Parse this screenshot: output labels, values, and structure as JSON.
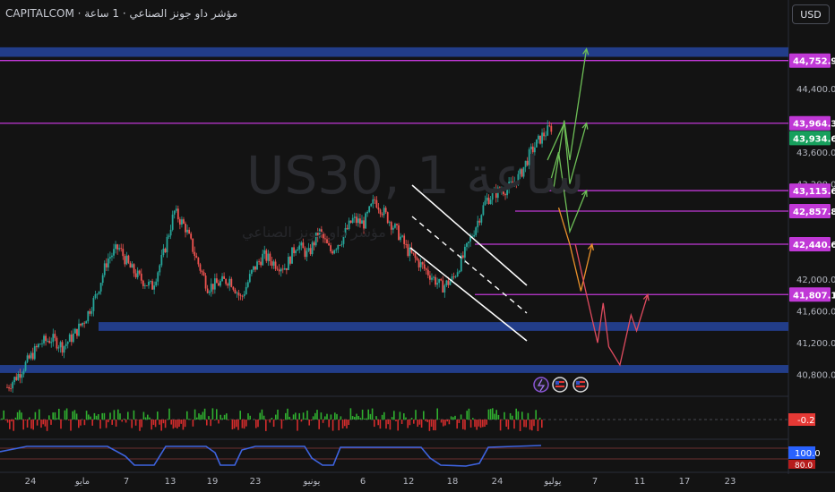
{
  "header": {
    "title": "CAPITALCOM ·  مؤشر داو جونز الصناعي · 1 ساعة",
    "currency_button": "USD"
  },
  "watermark": {
    "symbol": "US30, 1 ساعة",
    "subtitle": "مؤشر داو جونز الصناعي"
  },
  "colors": {
    "background": "#131313",
    "zone_blue": "#233f8f",
    "level_purple": "#c038d6",
    "candle_up": "#26a69a",
    "candle_down": "#ef5350",
    "projection_green": "#6ebf57",
    "projection_orange": "#e8902a",
    "projection_red": "#e04b5f",
    "channel": "#ffffff",
    "last_price_green": "#17a05d",
    "osc_up": "#2fae2f",
    "osc_down": "#d42c2c",
    "osc2_line": "#3e64e0"
  },
  "chart_data": {
    "type": "candlestick",
    "symbol": "US30",
    "interval": "1 ساعة",
    "y_axis": {
      "range": [
        40560,
        45200
      ],
      "ticks": [
        "44,400.0",
        "43,600.0",
        "43,200.0",
        "42,000.0",
        "41,600.0",
        "41,200.0",
        "40,800.0"
      ],
      "tick_values": [
        44400,
        43600,
        43200,
        42000,
        41600,
        41200,
        40800
      ]
    },
    "x_axis": {
      "labels": [
        "24",
        "مايو",
        "7",
        "13",
        "19",
        "23",
        "يونيو",
        "6",
        "12",
        "18",
        "24",
        "يوليو",
        "7",
        "11",
        "17",
        "23"
      ]
    },
    "price_labels": [
      {
        "text": "44,752.9",
        "value": 44752.9,
        "color": "#c038d6"
      },
      {
        "text": "43,964.3",
        "value": 43964.3,
        "color": "#c038d6"
      },
      {
        "text": "43,934.6",
        "value": 43934.6,
        "color": "#17a05d"
      },
      {
        "text": "43,115.6",
        "value": 43115.6,
        "color": "#c038d6"
      },
      {
        "text": "42,857.8",
        "value": 42857.8,
        "color": "#c038d6"
      },
      {
        "text": "42,440.6",
        "value": 42440.6,
        "color": "#c038d6"
      },
      {
        "text": "41,807.1",
        "value": 41807.1,
        "color": "#c038d6"
      }
    ],
    "horizontal_levels": [
      44752.9,
      43964.3,
      43115.6,
      42857.8,
      42440.6,
      41807.1
    ],
    "zones": [
      {
        "from": 44800,
        "to": 44920
      },
      {
        "from": 41350,
        "to": 41460
      },
      {
        "from": 40820,
        "to": 40920
      }
    ],
    "price_path_day": [
      0,
      2,
      4,
      6,
      8,
      10,
      12,
      14,
      16,
      18,
      20,
      22,
      24,
      26,
      28,
      30,
      32,
      34,
      36,
      38,
      40,
      42,
      44,
      46,
      48,
      50,
      52,
      54,
      56,
      58,
      60,
      62,
      64,
      66,
      68,
      70,
      72,
      74,
      76,
      78,
      80,
      82,
      84,
      86,
      88,
      90,
      92,
      94,
      96,
      98
    ],
    "price_path_close": [
      40640,
      40800,
      41000,
      41200,
      41250,
      41150,
      41300,
      41500,
      41800,
      42250,
      42400,
      42150,
      42000,
      41900,
      42300,
      42850,
      42650,
      42250,
      41900,
      41950,
      42000,
      41750,
      42100,
      42300,
      42200,
      42150,
      42450,
      42300,
      42600,
      42350,
      42500,
      42750,
      42700,
      43000,
      42800,
      42600,
      42350,
      42200,
      42050,
      41900,
      42000,
      42300,
      42650,
      43000,
      43100,
      43150,
      43300,
      43600,
      43800,
      43934.6
    ],
    "projections": [
      {
        "name": "",
        "color": "#6ebf57",
        "points": [
          [
            98,
            43100
          ],
          [
            100,
            44000
          ],
          [
            101,
            43500
          ],
          [
            104,
            44900
          ]
        ]
      },
      {
        "name": "",
        "color": "#6ebf57",
        "points": [
          [
            97,
            43500
          ],
          [
            100,
            43964
          ],
          [
            101,
            43200
          ],
          [
            104,
            43964
          ]
        ]
      },
      {
        "name": "",
        "color": "#6ebf57",
        "points": [
          [
            97,
            43100
          ],
          [
            99,
            43600
          ],
          [
            101,
            42600
          ],
          [
            104,
            43115
          ]
        ]
      },
      {
        "name": "",
        "color": "#e8902a",
        "points": [
          [
            99,
            42900
          ],
          [
            101,
            42440
          ],
          [
            103,
            41850
          ],
          [
            105,
            42440
          ]
        ]
      },
      {
        "name": "",
        "color": "#e04b5f",
        "points": [
          [
            102,
            42440
          ],
          [
            104,
            41807
          ],
          [
            106,
            41200
          ],
          [
            107,
            41700
          ],
          [
            108,
            41150
          ],
          [
            110,
            40920
          ],
          [
            112,
            41550
          ],
          [
            113,
            41350
          ],
          [
            115,
            41807
          ]
        ]
      }
    ],
    "oscillator_1": {
      "label": "-0.2",
      "value": -0.2
    },
    "oscillator_2": {
      "labels": [
        "100.0",
        "80.0"
      ],
      "values": [
        100.0,
        80.0
      ]
    }
  }
}
